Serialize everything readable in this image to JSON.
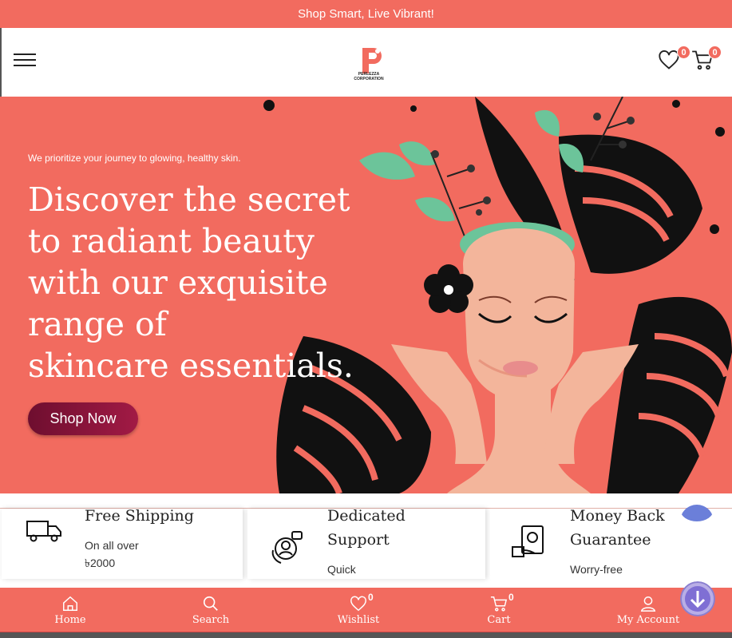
{
  "announcement": "Shop Smart, Live Vibrant!",
  "header": {
    "logo_text_line1": "PERLEZZA",
    "logo_text_line2": "CORPORATION",
    "logo_letter": "P",
    "wishlist_count": "0",
    "cart_count": "0"
  },
  "hero": {
    "tagline": "We prioritize your journey to glowing, healthy skin.",
    "title_lines": [
      "Discover the secret",
      "to radiant beauty",
      "with our exquisite",
      "range of",
      "skincare essentials."
    ],
    "cta_label": "Shop Now"
  },
  "features": [
    {
      "title_lines": [
        "Free Shipping"
      ],
      "sub_lines": [
        "On all over",
        "৳2000"
      ],
      "icon": "truck-icon"
    },
    {
      "title_lines": [
        "Dedicated",
        "Support"
      ],
      "sub_lines": [
        "Quick"
      ],
      "icon": "support-agent-icon"
    },
    {
      "title_lines": [
        "Money Back",
        "Guarantee"
      ],
      "sub_lines": [
        "Worry-free"
      ],
      "icon": "money-back-icon"
    }
  ],
  "bottom_nav": [
    {
      "label": "Home",
      "icon": "home-icon"
    },
    {
      "label": "Search",
      "icon": "search-icon"
    },
    {
      "label": "Wishlist",
      "icon": "heart-icon",
      "count": "0"
    },
    {
      "label": "Cart",
      "icon": "cart-icon",
      "count": "0"
    },
    {
      "label": "My Account",
      "icon": "user-icon"
    }
  ],
  "colors": {
    "brand": "#f26b5f",
    "cta": "#8b1538",
    "leaf": "#6cc49a",
    "leaf_dark": "#111111"
  }
}
